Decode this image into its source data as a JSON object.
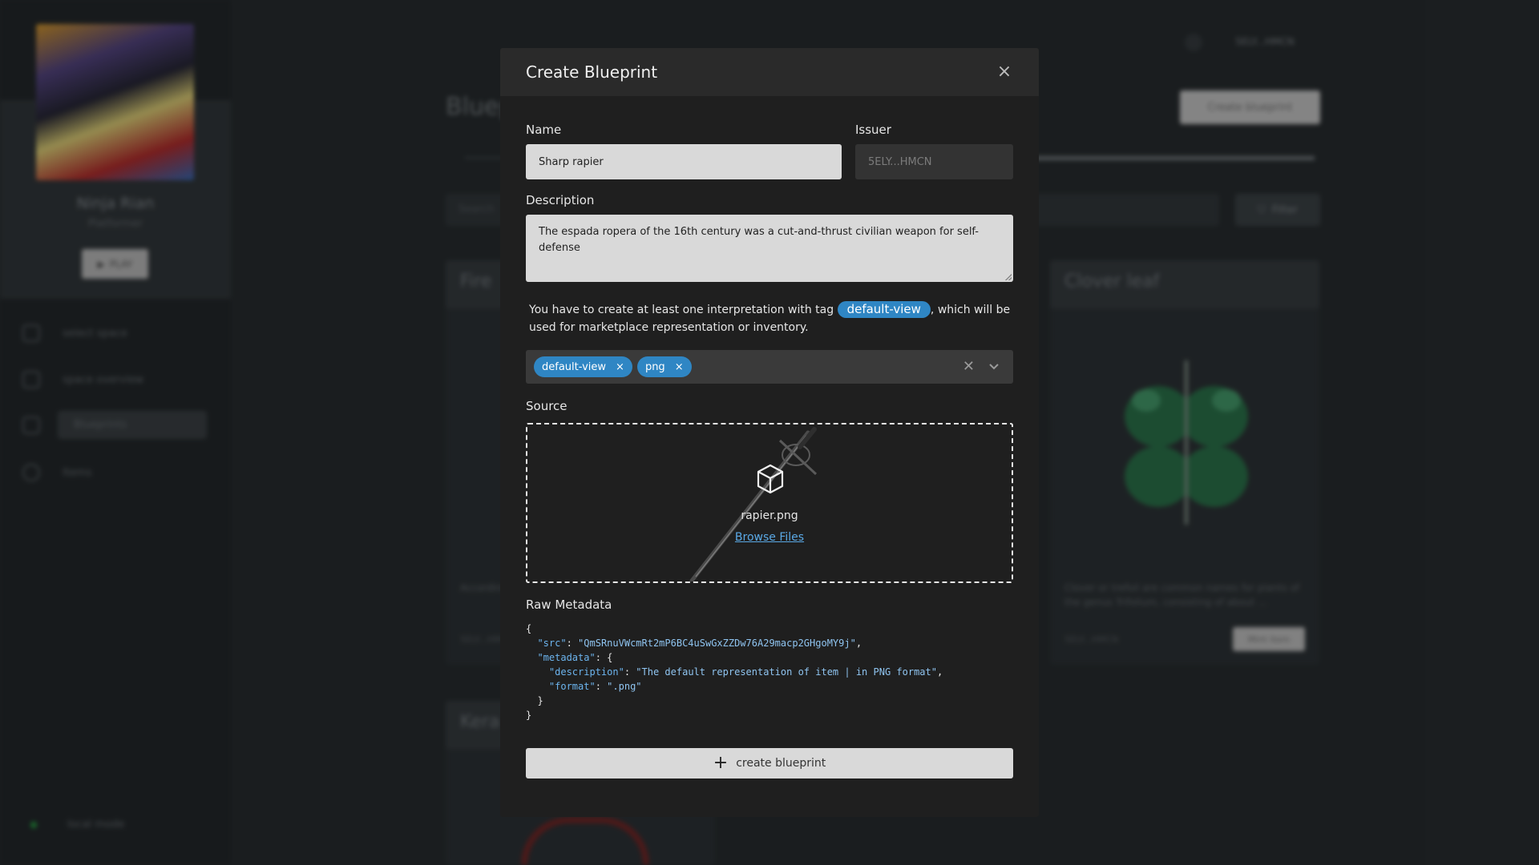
{
  "background": {
    "player": {
      "name": "Ninja Rian",
      "role": "Platformer",
      "play_label": "PLAY"
    },
    "nav": [
      {
        "label": "select space"
      },
      {
        "label": "space overview"
      },
      {
        "label": "Blueprints"
      },
      {
        "label": "Items"
      }
    ],
    "local_mode": "local mode",
    "wallet": "5ELY...HMCN",
    "page_title": "Blueprints",
    "create_button": "Create blueprint",
    "search_placeholder": "Search",
    "filter_label": "Filter",
    "cards": [
      {
        "title": "Fire",
        "description": "According to ...",
        "issuer": "5ELY...HMCN"
      },
      {
        "title": "Clover leaf",
        "description": "Clover or trefoil are common names for plants of the genus Trifolium, consisting of about ...",
        "issuer": "5ELY...HMCN",
        "button": "Mint item"
      },
      {
        "title": "Kera"
      }
    ]
  },
  "modal": {
    "title": "Create Blueprint",
    "name_label": "Name",
    "name_value": "Sharp rapier",
    "issuer_label": "Issuer",
    "issuer_value": "5ELY...HMCN",
    "description_label": "Description",
    "description_value": "The espada ropera of the 16th century was a cut-and-thrust civilian weapon for self-defense",
    "hint_before": "You have to create at least one interpretation with tag ",
    "hint_tag": "default-view",
    "hint_after": ", which will be used for marketplace representation or inventory.",
    "tags": [
      "default-view",
      "png"
    ],
    "source_label": "Source",
    "file_name": "rapier.png",
    "browse_label": "Browse Files",
    "raw_metadata_label": "Raw Metadata",
    "metadata": {
      "src": "QmSRnuVWcmRt2mP6BC4uSwGxZZDw76A29macp2GHgoMY9j",
      "description": "The default representation of item | in PNG format",
      "format": ".png"
    },
    "create_label": "create blueprint"
  },
  "colors": {
    "accent": "#2f86c4",
    "link": "#5aa9e6"
  }
}
